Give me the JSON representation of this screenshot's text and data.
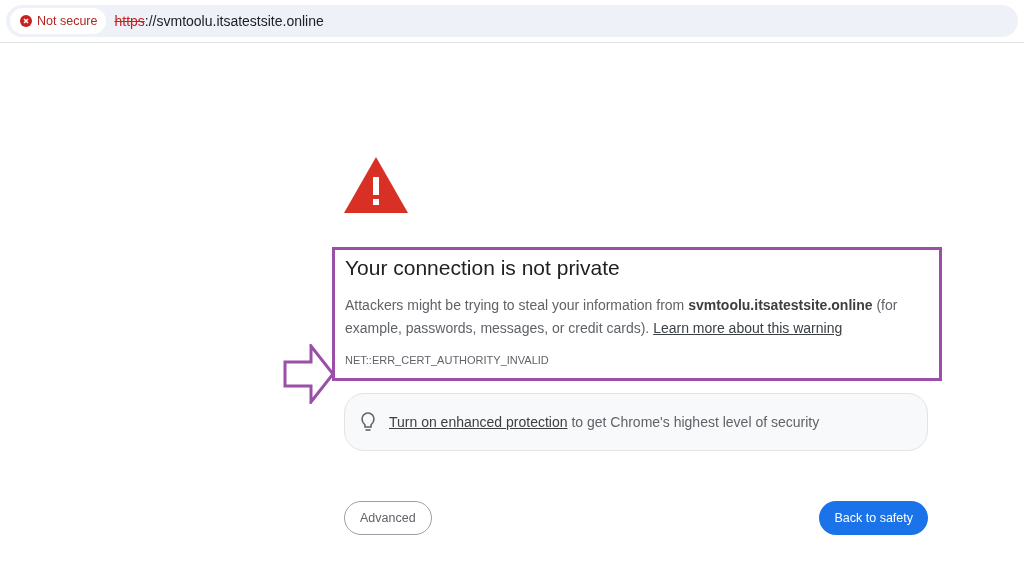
{
  "address_bar": {
    "security_chip": "Not secure",
    "scheme": "https",
    "url_rest": "://svmtoolu.itsatestsite.online"
  },
  "heading": "Your connection is not private",
  "body": "Attackers might be trying to steal your information from **svmtoolu.itsatestsite.online** (for example, passwords, messages, or credit cards).",
  "learn_more_link": "Learn more about this warning",
  "error_code": "NET::ERR_CERT_AUTHORITY_INVALID",
  "protection": {
    "link": "Turn on enhanced protection",
    "text": "to get Chrome's highest level of security"
  },
  "buttons": [
    {
      "kind": "secondary",
      "label": "Advanced"
    },
    {
      "kind": "primary",
      "label": "Back to safety"
    }
  ]
}
